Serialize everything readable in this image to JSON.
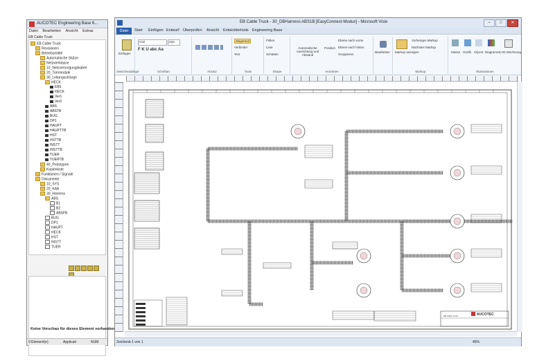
{
  "left_app": {
    "title": "AUCOTEC Engineering Base 6...",
    "menu": [
      "Datei",
      "Bearbeiten",
      "Ansicht",
      "Extras"
    ],
    "tree_root": "EB Cable Truck",
    "tree": [
      {
        "label": "EB Cable Truck",
        "depth": 0,
        "type": "fold"
      },
      {
        "label": "Revisionen",
        "depth": 1,
        "type": "fold"
      },
      {
        "label": "Betriebsmittel",
        "depth": 1,
        "type": "fold"
      },
      {
        "label": "Automatische Stütze",
        "depth": 2,
        "type": "fold"
      },
      {
        "label": "Netzwerklasse",
        "depth": 2,
        "type": "fold"
      },
      {
        "label": "10_Netzversorgungskabel",
        "depth": 2,
        "type": "fold"
      },
      {
        "label": "20_Tornmodule",
        "depth": 2,
        "type": "fold"
      },
      {
        "label": "30_Leitungsstränge",
        "depth": 2,
        "type": "fold"
      },
      {
        "label": "HECK",
        "depth": 3,
        "type": "fold"
      },
      {
        "label": "E8S",
        "depth": 4,
        "type": "plug"
      },
      {
        "label": "HECK",
        "depth": 4,
        "type": "plug"
      },
      {
        "label": "Ver1",
        "depth": 4,
        "type": "plug"
      },
      {
        "label": "Ver2",
        "depth": 4,
        "type": "plug"
      },
      {
        "label": "ABS",
        "depth": 3,
        "type": "plug"
      },
      {
        "label": "ABSTB",
        "depth": 3,
        "type": "plug"
      },
      {
        "label": "BUG",
        "depth": 3,
        "type": "plug"
      },
      {
        "label": "DP1",
        "depth": 3,
        "type": "plug"
      },
      {
        "label": "HAUPT",
        "depth": 3,
        "type": "plug"
      },
      {
        "label": "HAUPTTB",
        "depth": 3,
        "type": "plug"
      },
      {
        "label": "HST",
        "depth": 3,
        "type": "plug"
      },
      {
        "label": "HSTTB",
        "depth": 3,
        "type": "plug"
      },
      {
        "label": "INSTT",
        "depth": 3,
        "type": "plug"
      },
      {
        "label": "INSTTB",
        "depth": 3,
        "type": "plug"
      },
      {
        "label": "TUER",
        "depth": 3,
        "type": "plug"
      },
      {
        "label": "TUERTB",
        "depth": 3,
        "type": "plug"
      },
      {
        "label": "40_Prototypen",
        "depth": 2,
        "type": "fold"
      },
      {
        "label": "Kopierkiste",
        "depth": 2,
        "type": "fold"
      },
      {
        "label": "Funktionen / Signale",
        "depth": 1,
        "type": "fold"
      },
      {
        "label": "Dokumente",
        "depth": 1,
        "type": "fold"
      },
      {
        "label": "10_SYS",
        "depth": 2,
        "type": "fold"
      },
      {
        "label": "20_KAB",
        "depth": 2,
        "type": "fold"
      },
      {
        "label": "30_Harness",
        "depth": 2,
        "type": "fold"
      },
      {
        "label": "ABS",
        "depth": 3,
        "type": "fold"
      },
      {
        "label": "B1",
        "depth": 4,
        "type": "doc"
      },
      {
        "label": "B2",
        "depth": 4,
        "type": "doc"
      },
      {
        "label": "ABSFB",
        "depth": 4,
        "type": "doc"
      },
      {
        "label": "BUG",
        "depth": 3,
        "type": "doc"
      },
      {
        "label": "DP1",
        "depth": 3,
        "type": "doc"
      },
      {
        "label": "HAUPT",
        "depth": 3,
        "type": "doc"
      },
      {
        "label": "HECK",
        "depth": 3,
        "type": "doc"
      },
      {
        "label": "HST",
        "depth": 3,
        "type": "doc"
      },
      {
        "label": "INSTT",
        "depth": 3,
        "type": "doc"
      },
      {
        "label": "TUER",
        "depth": 3,
        "type": "doc"
      }
    ],
    "preview_text": "Keine Vorschau für dieses Element vorhanden.",
    "status": {
      "count": "0 Element(e)",
      "mode": "Applicati",
      "user": "NUM"
    }
  },
  "visio": {
    "title": "EB Cable Truck - 30_DBHarness ABS1B [EasyConnect-Modus] - Microsoft Visio",
    "tabs": [
      "Datei",
      "Start",
      "Einfügen",
      "Entwurf",
      "Überprüfen",
      "Ansicht",
      "Entwicklertools",
      "Engineering Base"
    ],
    "ribbon_groups": [
      {
        "label": "Zwischenablage",
        "buttons": [
          "Einfügen"
        ]
      },
      {
        "label": "Schriftart",
        "buttons": [
          "Arial",
          "12pt."
        ]
      },
      {
        "label": "Absatz",
        "buttons": []
      },
      {
        "label": "Tools",
        "buttons": [
          "Zeigertool",
          "Verbinder",
          "Text"
        ]
      },
      {
        "label": "Shape",
        "buttons": [
          "Füllen",
          "Linie",
          "Schatten"
        ]
      },
      {
        "label": "Anordnen",
        "buttons": [
          "Automatische Ausrichtung und Abstand",
          "Position",
          "Ebene nach vorne",
          "Ebene nach hinten",
          "Gruppieren"
        ]
      },
      {
        "label": "Bearbeiten",
        "buttons": [
          "Bearbeiten"
        ]
      },
      {
        "label": "Markup",
        "buttons": [
          "Markup anzeigen",
          "Vorheriges Markup",
          "Nächstes Markup"
        ]
      },
      {
        "label": "Illustrationen",
        "buttons": [
          "Masse",
          "Grafik",
          "ClipArt",
          "Diagramm",
          "CAD-Zeichnung"
        ]
      }
    ],
    "page_label": "Zeichenb-1 von 1",
    "zoom": "46%",
    "title_block": {
      "company": "AUCOTEC",
      "project": "EB Cable Truck"
    }
  }
}
